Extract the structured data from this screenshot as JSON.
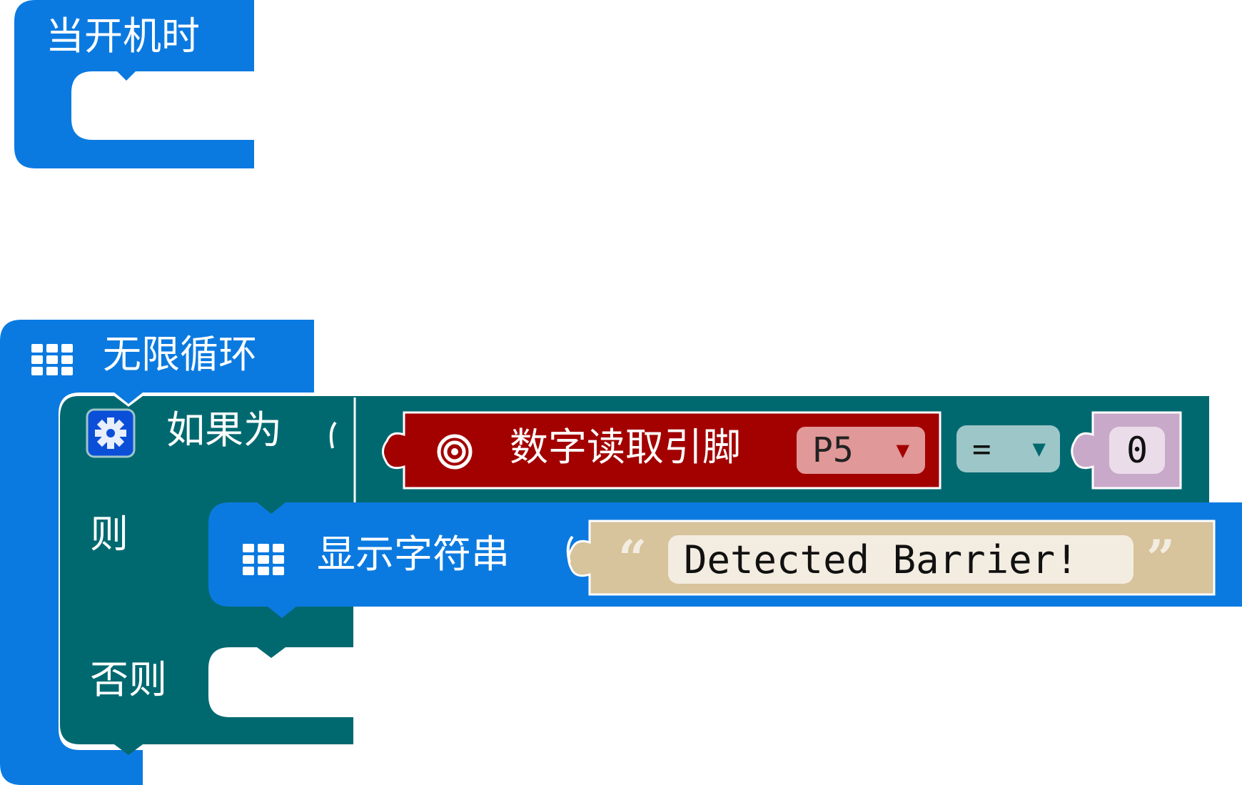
{
  "colors": {
    "basic_blue": "#0b7ae0",
    "logic_teal": "#006970",
    "pins_red": "#a30000",
    "pin_field": "#e09898",
    "compare_field": "#9dc6c8",
    "number_block": "#c9a9c9",
    "text_block": "#d7c39c",
    "field_light": "#f3ece0"
  },
  "on_start": {
    "label": "当开机时"
  },
  "forever": {
    "label": "无限循环",
    "icon": "led-grid-icon"
  },
  "if_block": {
    "if_label": "如果为",
    "then_label": "则",
    "else_label": "否则",
    "gear_icon": "gear-icon",
    "condition": {
      "read_pin_label": "数字读取引脚",
      "pin_icon": "target-icon",
      "pin_value": "P5",
      "operator": "=",
      "compare_value": "0"
    }
  },
  "show_string": {
    "label": "显示字符串",
    "icon": "led-grid-icon",
    "open_quote": "“",
    "text": "Detected Barrier!",
    "close_quote": "”"
  }
}
